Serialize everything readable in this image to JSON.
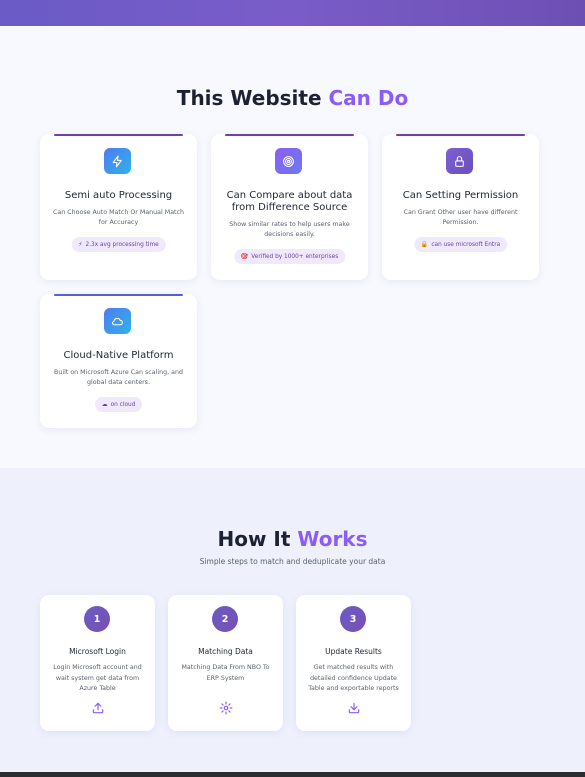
{
  "features": {
    "title_main": "This Website ",
    "title_accent": "Can Do",
    "cards": [
      {
        "title": "Semi auto Processing",
        "desc": "Can Choose Auto Match Or Manual Match for Accuracy",
        "badge_icon": "⚡",
        "badge": "2.3x avg processing time",
        "icon": "lightning-icon"
      },
      {
        "title": "Can Compare about data from Difference Source",
        "desc": "Show similar rates to help users make decisions easily.",
        "badge_icon": "🎯",
        "badge": "Verified by 1000+ enterprises",
        "icon": "target-icon"
      },
      {
        "title": "Can Setting Permission",
        "desc": "Can Grant Other user have different Permission.",
        "badge_icon": "🔒",
        "badge": "can use microsoft Entra",
        "icon": "lock-icon"
      },
      {
        "title": "Cloud-Native Platform",
        "desc": "Built on Microsoft Azure Can scaling, and global data centers.",
        "badge_icon": "☁",
        "badge": "on cloud",
        "icon": "cloud-icon"
      }
    ]
  },
  "how": {
    "title_main": "How It ",
    "title_accent": "Works",
    "subtitle": "Simple steps to match and deduplicate your data",
    "steps": [
      {
        "num": "1",
        "title": "Microsoft Login",
        "desc": "Login Microsoft account and wait system get data from Azure Table",
        "icon": "upload-icon"
      },
      {
        "num": "2",
        "title": "Matching Data",
        "desc": "Matching Data From NBO To ERP System",
        "icon": "gear-icon"
      },
      {
        "num": "3",
        "title": "Update Results",
        "desc": "Get matched results with detailed confidence Update Table and exportable reports",
        "icon": "download-icon"
      }
    ]
  },
  "colors": {
    "accent": "#8b5cf6",
    "header_gradient": "#6a5bc6",
    "badge_bg": "#efe9fb"
  }
}
